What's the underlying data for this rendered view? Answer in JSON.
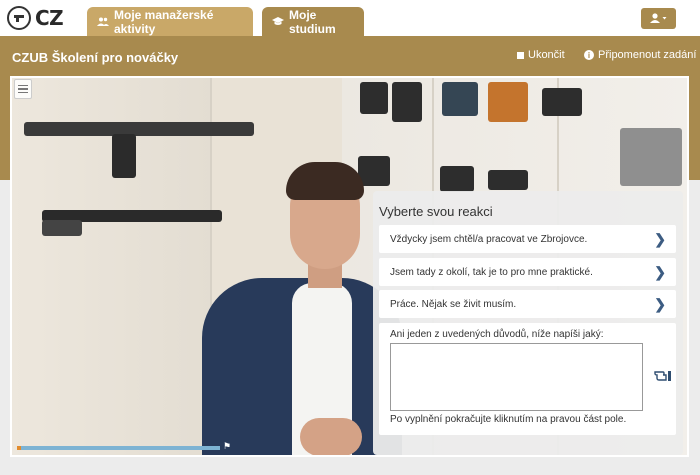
{
  "brand": {
    "logo_text": "CZ"
  },
  "tabs": [
    {
      "label": "Moje manažerské aktivity",
      "icon": "users-icon"
    },
    {
      "label": "Moje studium",
      "icon": "graduation-cap-icon"
    }
  ],
  "user_menu": {
    "icon": "user-icon"
  },
  "course": {
    "title": "CZUB Školení pro nováčky",
    "end_label": "Ukončit",
    "remind_label": "Připomenout zadání"
  },
  "video": {
    "progress_fraction": 0.02
  },
  "reaction": {
    "title": "Vyberte svou reakci",
    "options": [
      "Vždycky jsem chtěl/a pracovat ve Zbrojovce.",
      "Jsem tady z okolí, tak je to pro mne praktické.",
      "Práce. Nějak se živit musím."
    ],
    "other_label": "Ani jeden z uvedených důvodů, níže napíši jaký:",
    "other_value": "",
    "other_hint": "Po vyplnění pokračujte kliknutím na pravou část pole."
  },
  "colors": {
    "accent": "#a88a4e",
    "tab_light": "#c9a868",
    "chevron": "#3c5c82",
    "progress": "#e28b2c"
  }
}
